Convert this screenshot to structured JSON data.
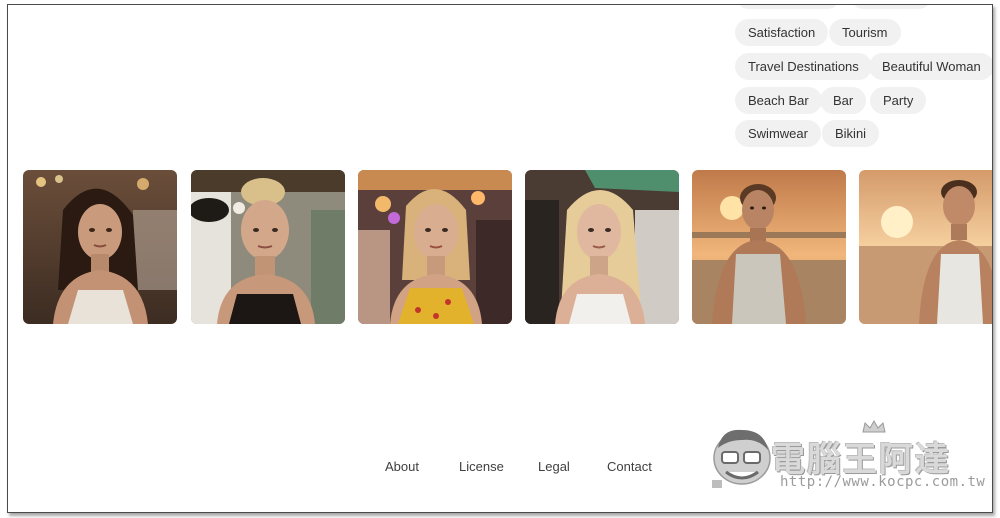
{
  "tags": [
    {
      "label": "Satisfaction"
    },
    {
      "label": "Tourism"
    },
    {
      "label": "Travel Destinations"
    },
    {
      "label": "Beautiful Woman"
    },
    {
      "label": "Beach Bar"
    },
    {
      "label": "Bar"
    },
    {
      "label": "Party"
    },
    {
      "label": "Swimwear"
    },
    {
      "label": "Bikini"
    }
  ],
  "gallery": [
    {
      "subject": "woman-dark-hair-beach-party"
    },
    {
      "subject": "woman-blonde-bun-beach-party"
    },
    {
      "subject": "woman-blonde-yellow-top-party"
    },
    {
      "subject": "woman-blonde-long-hair-party"
    },
    {
      "subject": "man-tank-top-beach-sunset"
    },
    {
      "subject": "man-tank-top-beach-sunset-2"
    }
  ],
  "footer": {
    "about": "About",
    "license": "License",
    "legal": "Legal",
    "contact": "Contact"
  },
  "watermark": {
    "title": "電腦王阿達",
    "url": "http://www.kocpc.com.tw"
  }
}
